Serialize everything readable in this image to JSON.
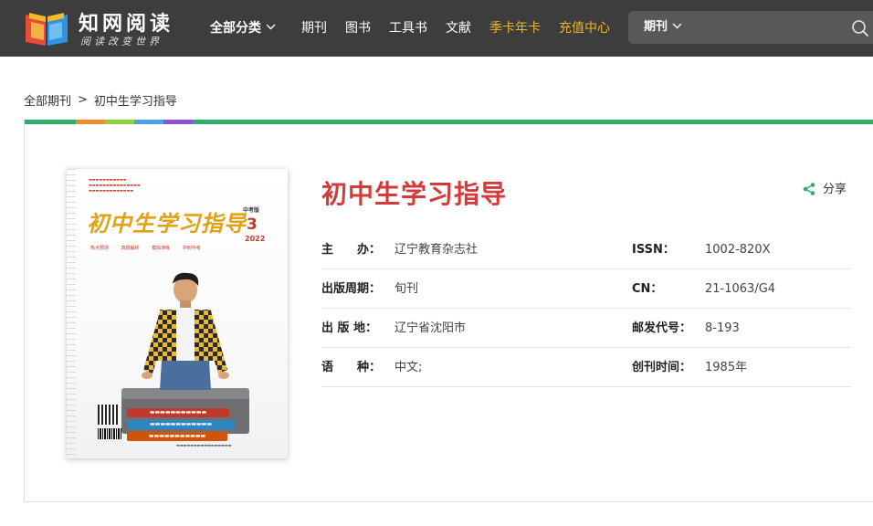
{
  "header": {
    "logo": {
      "title": "知网阅读",
      "slogan": "阅读改变世界"
    },
    "nav": {
      "all_categories": "全部分类",
      "journals": "期刊",
      "books": "图书",
      "reference_books": "工具书",
      "literature": "文献",
      "season_year_card": "季卡年卡",
      "recharge_center": "充值中心"
    },
    "search": {
      "type": "期刊",
      "placeholder": ""
    }
  },
  "breadcrumb": {
    "root": "全部期刊",
    "separator": ">",
    "current": "初中生学习指导"
  },
  "journal": {
    "title": "初中生学习指导",
    "share_label": "分享",
    "cover": {
      "title": "初中生学习指导",
      "edition": "中考版",
      "issue": "3",
      "year": "2022",
      "tags": "热点预测 真题解析 模拟演练 冲刺中考"
    },
    "info": [
      {
        "label": "主　　办：",
        "value": "辽宁教育杂志社",
        "label2": "ISSN：",
        "value2": "1002-820X"
      },
      {
        "label": "出版周期：",
        "value": "旬刊",
        "label2": "CN：",
        "value2": "21-1063/G4"
      },
      {
        "label": "出 版 地：",
        "value": "辽宁省沈阳市",
        "label2": "邮发代号：",
        "value2": "8-193"
      },
      {
        "label": "语　　种：",
        "value": "中文;",
        "label2": "创刊时间：",
        "value2": "1985年"
      }
    ]
  },
  "colors": {
    "header_bg": "#3d3d3d",
    "highlight_nav": "#f0b429",
    "title_red": "#d6393a",
    "accent_green": "#2fad6b",
    "tab_strip": [
      "#f08c2e",
      "#8ed13e",
      "#4aa3e8",
      "#8b52d9"
    ]
  },
  "icons": {
    "logo": "open-book-icon",
    "dropdown": "chevron-down-icon",
    "search": "search-icon",
    "share": "share-icon"
  }
}
